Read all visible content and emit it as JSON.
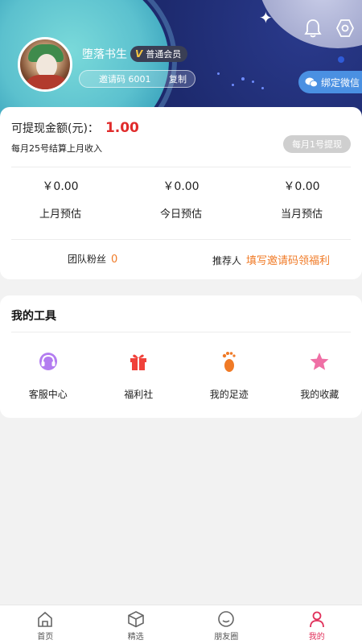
{
  "profile": {
    "username": "堕落书生",
    "member_badge_v": "V",
    "member_level": "普通会员",
    "invite_code": "邀请码 6001",
    "copy_label": "复制",
    "bind_wechat": "绑定微信"
  },
  "earnings": {
    "withdrawable_label": "可提现金额(元)：",
    "withdrawable_amount": "1.00",
    "settle_note": "每月25号结算上月收入",
    "withdraw_button": "每月1号提现",
    "stats": [
      {
        "value": "￥0.00",
        "label": "上月预估"
      },
      {
        "value": "￥0.00",
        "label": "今日预估"
      },
      {
        "value": "￥0.00",
        "label": "当月预估"
      }
    ],
    "team_fans_label": "团队粉丝",
    "team_fans_count": "0",
    "referrer_label": "推荐人",
    "referrer_link": "填写邀请码领福利"
  },
  "tools": {
    "title": "我的工具",
    "items": [
      {
        "label": "客服中心",
        "icon": "headset-icon"
      },
      {
        "label": "福利社",
        "icon": "gift-icon"
      },
      {
        "label": "我的足迹",
        "icon": "footprint-icon"
      },
      {
        "label": "我的收藏",
        "icon": "star-icon"
      }
    ]
  },
  "tabbar": {
    "items": [
      {
        "label": "首页",
        "icon": "home-icon"
      },
      {
        "label": "精选",
        "icon": "box-icon"
      },
      {
        "label": "朋友圈",
        "icon": "chat-icon"
      },
      {
        "label": "我的",
        "icon": "user-icon"
      }
    ],
    "active_color": "#e0305a"
  },
  "colors": {
    "accent_red": "#e02b2b",
    "accent_orange": "#f07a26",
    "header_navy": "#1d2a6e"
  }
}
